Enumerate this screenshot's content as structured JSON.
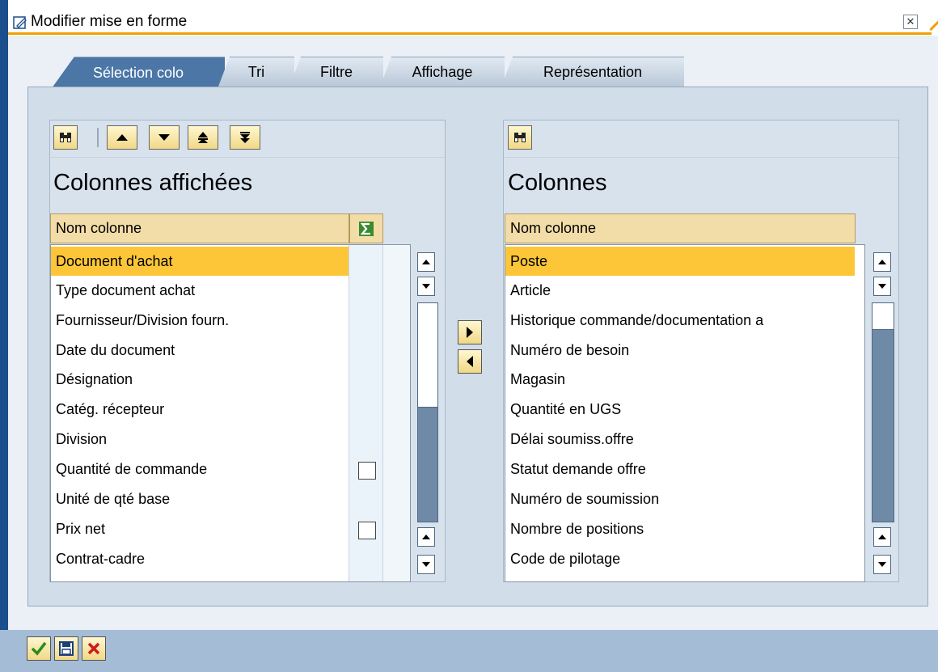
{
  "window": {
    "title": "Modifier mise en forme"
  },
  "tabs": [
    {
      "label": "Sélection colo",
      "active": true
    },
    {
      "label": "Tri"
    },
    {
      "label": "Filtre"
    },
    {
      "label": "Affichage"
    },
    {
      "label": "Représentation"
    }
  ],
  "left": {
    "heading": "Colonnes affichées",
    "column_header": "Nom colonne",
    "rows": [
      "Document d'achat",
      "Type document achat",
      "Fournisseur/Division fourn.",
      "Date du document",
      "Désignation",
      "Catég. récepteur",
      "Division",
      "Quantité de commande",
      "Unité de qté base",
      "Prix net",
      "Contrat-cadre"
    ],
    "selected_row": 0
  },
  "right": {
    "heading": "Colonnes",
    "column_header": "Nom colonne",
    "rows": [
      "Poste",
      "Article",
      "Historique commande/documentation a",
      "Numéro de besoin",
      "Magasin",
      "Quantité en UGS",
      "Délai soumiss.offre",
      "Statut demande offre",
      "Numéro de soumission",
      "Nombre de positions",
      "Code de pilotage"
    ],
    "selected_row": 0
  },
  "icons": {
    "find": "binoculars-icon",
    "up": "arrow-up-icon",
    "down": "arrow-down-icon",
    "top": "arrow-top-icon",
    "bottom": "arrow-bottom-icon",
    "sum": "sigma-icon",
    "move_right": "arrow-right-icon",
    "move_left": "arrow-left-icon",
    "confirm": "checkmark-icon",
    "save": "save-icon",
    "cancel": "cancel-icon"
  },
  "colors": {
    "accent": "#f0a000",
    "selection": "#fcc638",
    "active_tab": "#4b76a6",
    "window_edge": "#1b4e8c"
  }
}
